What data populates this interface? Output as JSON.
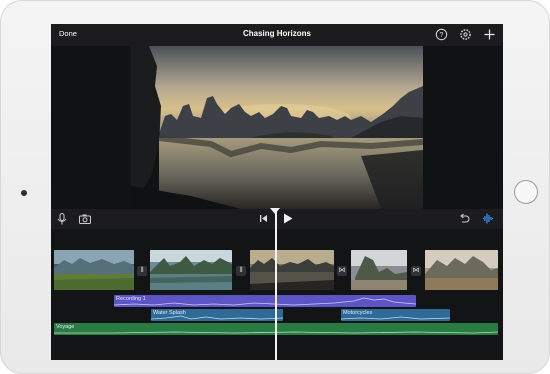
{
  "topbar": {
    "done_label": "Done",
    "title": "Chasing Horizons",
    "icons": [
      "help-icon",
      "settings-icon",
      "add-icon"
    ]
  },
  "controls": {
    "icons": [
      "microphone-icon",
      "camera-icon",
      "skip-to-start-icon",
      "play-icon",
      "undo-icon",
      "audio-waveform-icon"
    ]
  },
  "audio_tracks": {
    "recording": "Recording 1",
    "water": "Water Splash",
    "motorcycles": "Motorcycles",
    "voyage": "Voyage"
  },
  "colors": {
    "accent": "#3b8cf5",
    "recording_track": "#5d55c6",
    "water_track": "#2f6a96",
    "voyage_track": "#2a7a44"
  }
}
